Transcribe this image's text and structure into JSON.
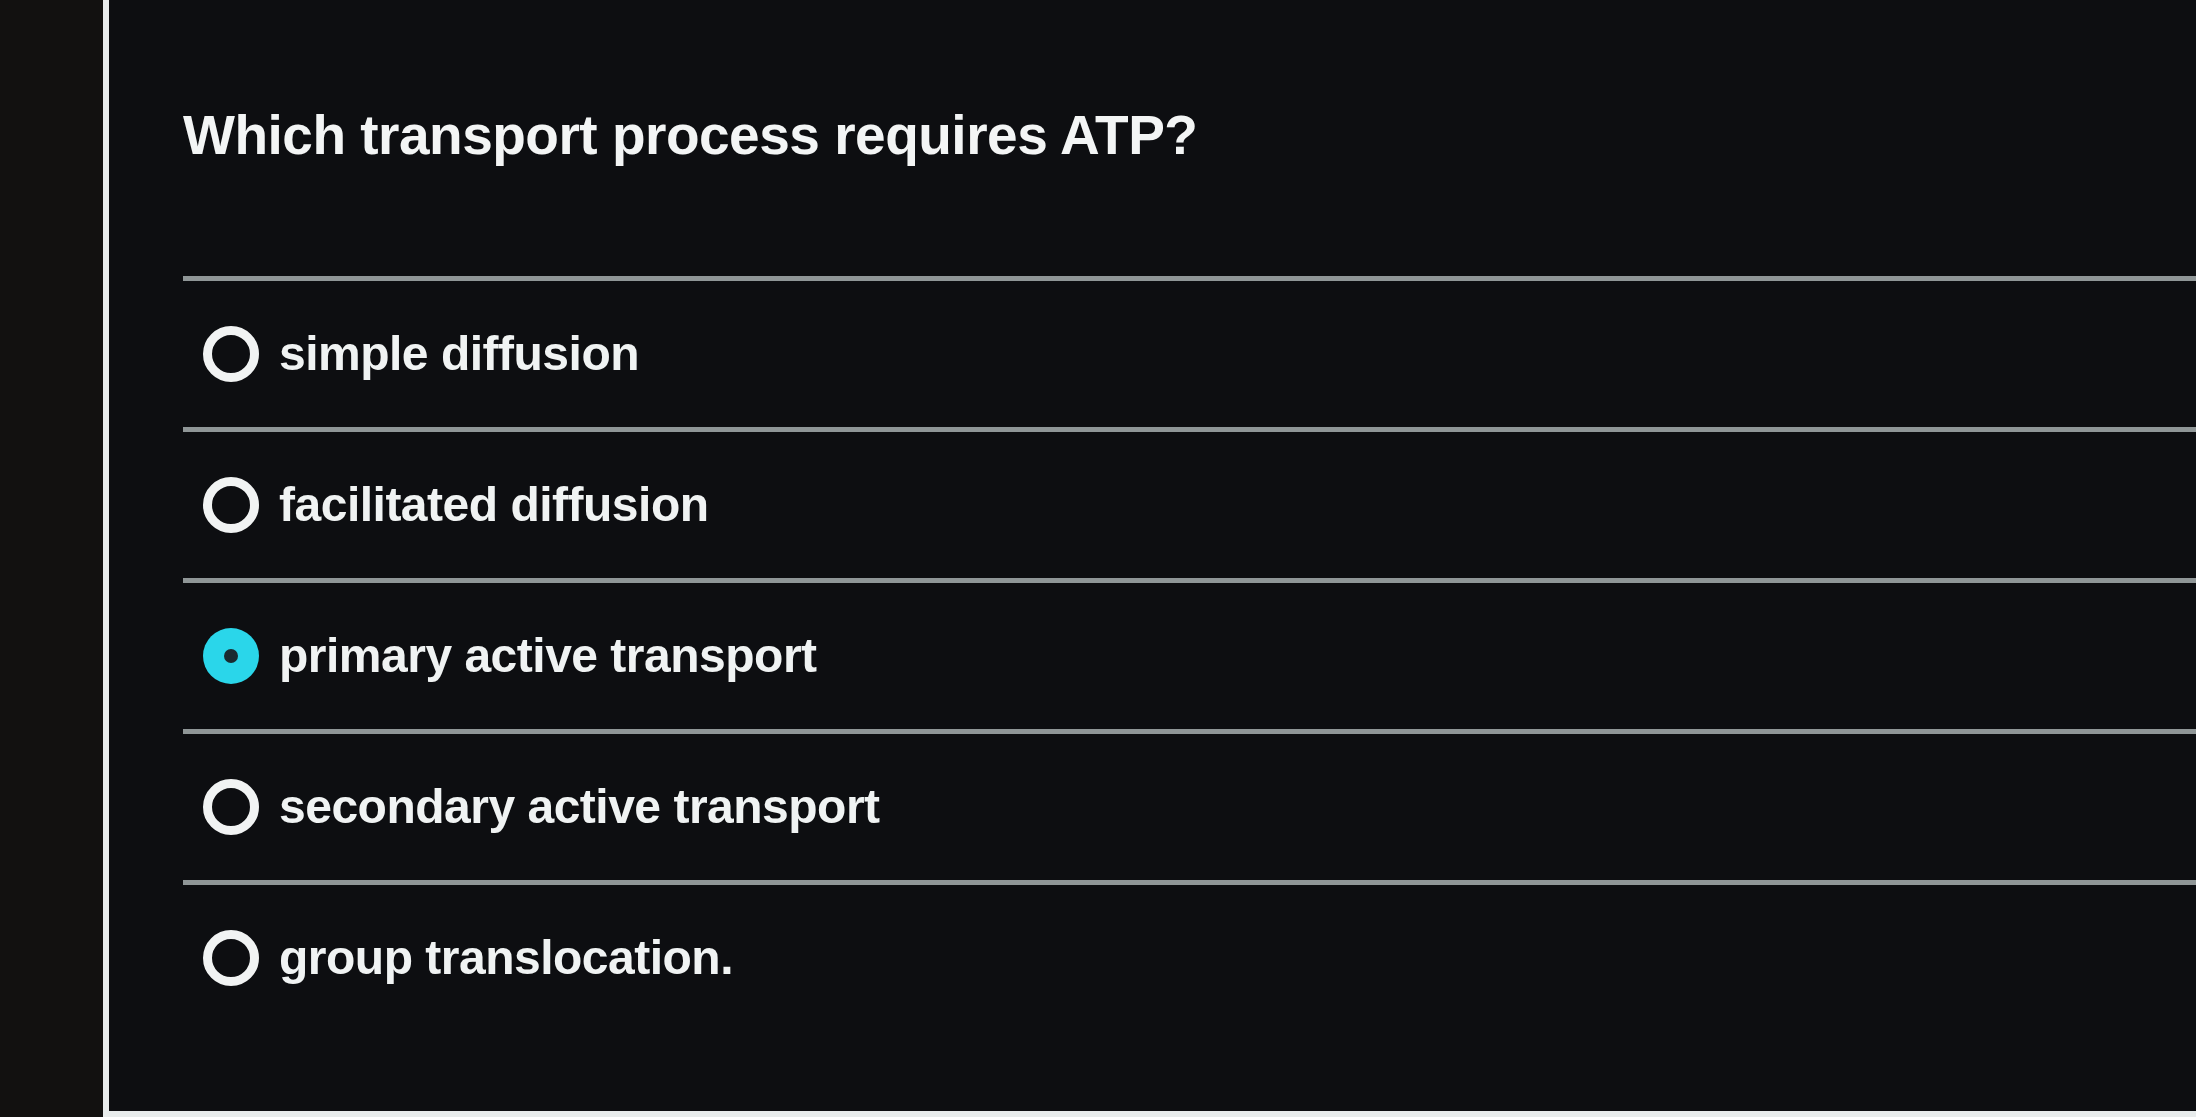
{
  "question": "Which transport process requires ATP?",
  "options": [
    {
      "label": "simple diffusion",
      "selected": false
    },
    {
      "label": "facilitated diffusion",
      "selected": false
    },
    {
      "label": "primary active transport",
      "selected": true
    },
    {
      "label": "secondary active transport",
      "selected": false
    },
    {
      "label": "group translocation.",
      "selected": false
    }
  ]
}
